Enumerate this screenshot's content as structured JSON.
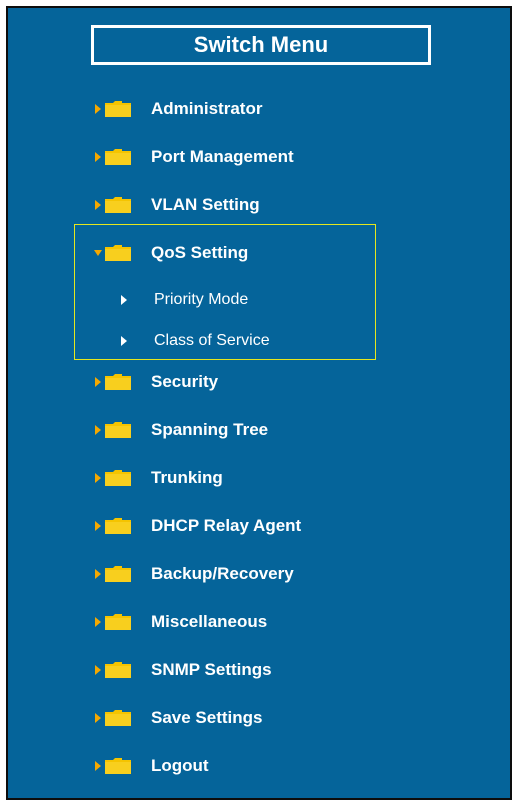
{
  "menu": {
    "title": "Switch Menu",
    "items": [
      {
        "label": "Administrator",
        "expanded": false
      },
      {
        "label": "Port Management",
        "expanded": false
      },
      {
        "label": "VLAN Setting",
        "expanded": false
      },
      {
        "label": "QoS Setting",
        "expanded": true,
        "children": [
          {
            "label": "Priority Mode"
          },
          {
            "label": "Class of Service"
          }
        ]
      },
      {
        "label": "Security",
        "expanded": false
      },
      {
        "label": "Spanning Tree",
        "expanded": false
      },
      {
        "label": "Trunking",
        "expanded": false
      },
      {
        "label": "DHCP Relay Agent",
        "expanded": false
      },
      {
        "label": "Backup/Recovery",
        "expanded": false
      },
      {
        "label": "Miscellaneous",
        "expanded": false
      },
      {
        "label": "SNMP Settings",
        "expanded": false
      },
      {
        "label": "Save Settings",
        "expanded": false
      },
      {
        "label": "Logout",
        "expanded": false
      }
    ]
  },
  "colors": {
    "panel_background": "#05649a",
    "text": "#ffffff",
    "folder": "#f5c400",
    "arrow": "#f5a800",
    "highlight_border": "#e6e61e"
  },
  "icons": {
    "collapsed_arrow": "caret-right-icon",
    "expanded_arrow": "caret-down-icon",
    "folder": "folder-icon",
    "sub_arrow": "triangle-right-icon"
  }
}
